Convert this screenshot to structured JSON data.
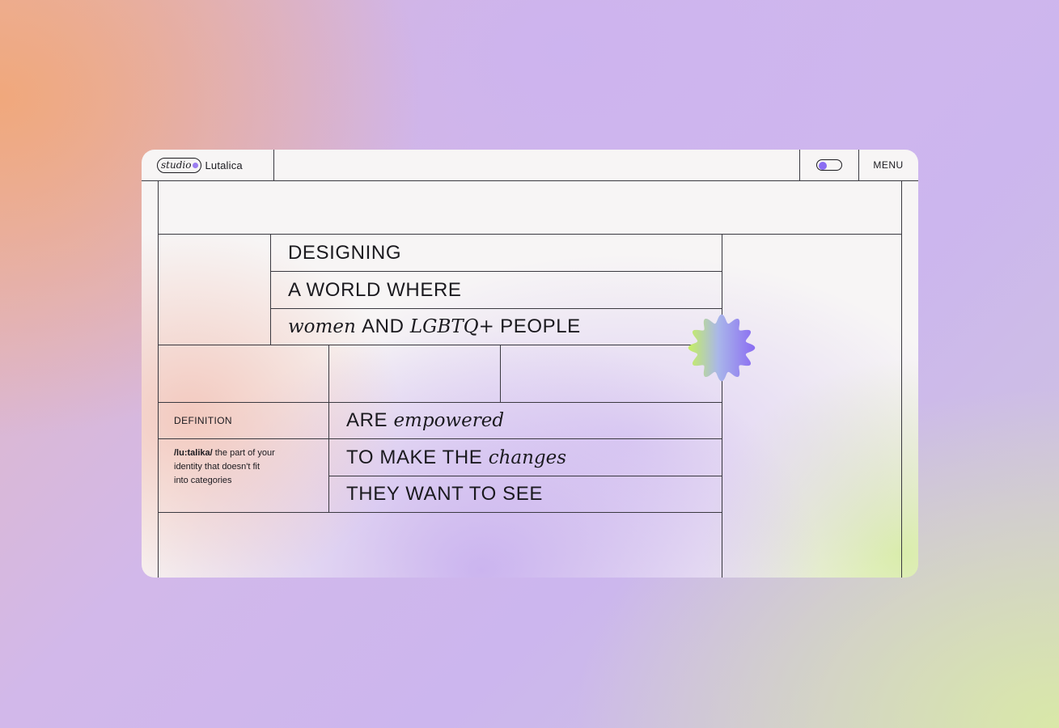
{
  "nav": {
    "logo": {
      "left_word": "studio",
      "right_word": "Lutalica"
    },
    "theme_toggle": {
      "state": "on"
    },
    "menu_label": "MENU"
  },
  "hero": {
    "line1": "DESIGNING",
    "line2": "A WORLD WHERE",
    "line3": {
      "italic1": "women",
      "text1": "AND",
      "italic2": "LGBTQ+",
      "text2": "PEOPLE"
    },
    "line4": {
      "text": "ARE",
      "italic": "empowered"
    },
    "line5": {
      "text": "TO MAKE THE",
      "italic": "changes"
    },
    "line6": "THEY WANT TO SEE"
  },
  "definition": {
    "label": "DEFINITION",
    "term": "/lu:talika/",
    "line1_rest": "the part of your",
    "line2": "identity that doesn't fit",
    "line3": "into categories"
  },
  "colors": {
    "badge_green": "#c6f062",
    "badge_purple": "#8a6cf2",
    "toggle_knob": "#8a6cf2",
    "lines": "#3a3940"
  },
  "icons": {
    "badge": "wavy-star-badge-icon"
  }
}
